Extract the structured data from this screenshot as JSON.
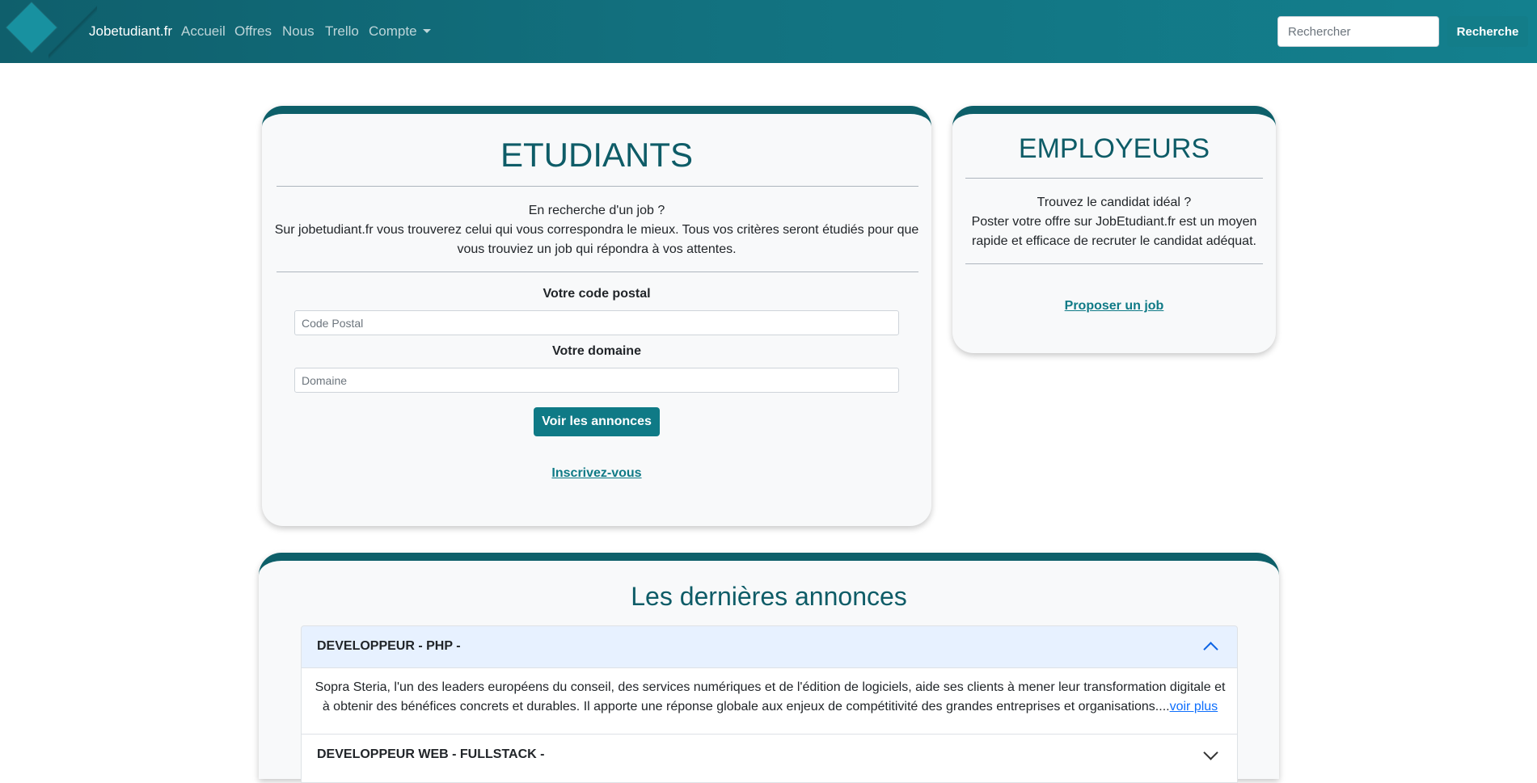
{
  "nav": {
    "brand": "Jobetudiant.fr",
    "links": [
      "Accueil",
      "Offres",
      "Nous",
      "Trello",
      "Compte"
    ],
    "search_placeholder": "Rechercher",
    "search_button": "Recherche"
  },
  "students": {
    "title": "ETUDIANTS",
    "intro_line1": "En recherche d'un job ?",
    "intro_line2": "Sur jobetudiant.fr vous trouverez celui qui vous correspondra le mieux. Tous vos critères seront étudiés pour que",
    "intro_line3": "vous trouviez un job qui répondra à vos attentes.",
    "postal_label": "Votre code postal",
    "postal_placeholder": "Code Postal",
    "domain_label": "Votre domaine",
    "domain_placeholder": "Domaine",
    "submit": "Voir les annonces",
    "register": "Inscrivez-vous"
  },
  "employers": {
    "title": "EMPLOYEURS",
    "line1": "Trouvez le candidat idéal ?",
    "line2": "Poster votre offre sur JobEtudiant.fr est un moyen",
    "line3": "rapide et efficace de recruter le candidat adéquat.",
    "cta": "Proposer un job"
  },
  "latest": {
    "title": "Les dernières annonces",
    "items": [
      {
        "title": "DEVELOPPEUR - PHP -",
        "expanded": true,
        "line1": "Sopra Steria, l'un des leaders européens du conseil, des services numériques et de l'édition de logiciels, aide ses clients à mener leur transformation digitale et",
        "line2": "à obtenir des bénéfices concrets et durables. Il apporte une réponse globale aux enjeux de compétitivité des grandes entreprises et organisations....",
        "more": "voir plus"
      },
      {
        "title": "DEVELOPPEUR WEB - FULLSTACK -",
        "expanded": false
      }
    ]
  }
}
